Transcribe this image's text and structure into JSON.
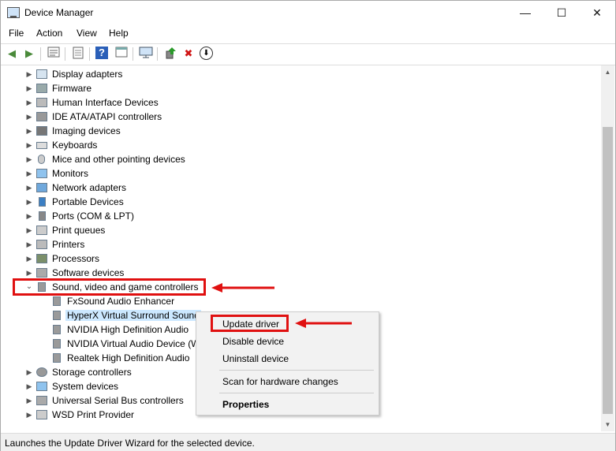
{
  "window": {
    "title": "Device Manager",
    "controls": {
      "minimize": "—",
      "maximize": "☐",
      "close": "✕"
    }
  },
  "menu": [
    "File",
    "Action",
    "View",
    "Help"
  ],
  "toolbar": {
    "icons": [
      "back-arrow-icon",
      "forward-arrow-icon",
      "properties-icon",
      "document-icon",
      "help-icon",
      "view-icon",
      "monitor-scan-icon",
      "update-driver-icon",
      "uninstall-x-icon",
      "download-icon"
    ],
    "glyphs": {
      "back": "◀",
      "forward": "▶",
      "help": "?",
      "uninstall": "✖",
      "download": "⬇"
    }
  },
  "tree": {
    "categories": [
      {
        "label": "Display adapters",
        "icon": "monitor-icon"
      },
      {
        "label": "Firmware",
        "icon": "chip-icon"
      },
      {
        "label": "Human Interface Devices",
        "icon": "hid-icon"
      },
      {
        "label": "IDE ATA/ATAPI controllers",
        "icon": "ide-icon"
      },
      {
        "label": "Imaging devices",
        "icon": "camera-icon"
      },
      {
        "label": "Keyboards",
        "icon": "keyboard-icon"
      },
      {
        "label": "Mice and other pointing devices",
        "icon": "mouse-icon"
      },
      {
        "label": "Monitors",
        "icon": "monitor-icon"
      },
      {
        "label": "Network adapters",
        "icon": "network-icon"
      },
      {
        "label": "Portable Devices",
        "icon": "portable-device-icon"
      },
      {
        "label": "Ports (COM & LPT)",
        "icon": "port-icon"
      },
      {
        "label": "Print queues",
        "icon": "printer-icon"
      },
      {
        "label": "Printers",
        "icon": "printer-icon"
      },
      {
        "label": "Processors",
        "icon": "cpu-icon"
      },
      {
        "label": "Software devices",
        "icon": "software-icon"
      },
      {
        "label": "Sound, video and game controllers",
        "icon": "speaker-icon",
        "expanded": true
      }
    ],
    "sound_children": [
      "FxSound Audio Enhancer",
      "HyperX Virtual Surround Sound",
      "NVIDIA High Definition Audio",
      "NVIDIA Virtual Audio Device (W",
      "Realtek High Definition Audio"
    ],
    "after_categories": [
      {
        "label": "Storage controllers",
        "icon": "gear-icon"
      },
      {
        "label": "System devices",
        "icon": "system-icon"
      },
      {
        "label": "Universal Serial Bus controllers",
        "icon": "usb-icon"
      },
      {
        "label": "WSD Print Provider",
        "icon": "printer-icon"
      }
    ]
  },
  "context_menu": {
    "items": [
      "Update driver",
      "Disable device",
      "Uninstall device",
      "Scan for hardware changes",
      "Properties"
    ]
  },
  "status": "Launches the Update Driver Wizard for the selected device.",
  "colors": {
    "highlight": "#e01010",
    "selection": "#cce8ff"
  }
}
